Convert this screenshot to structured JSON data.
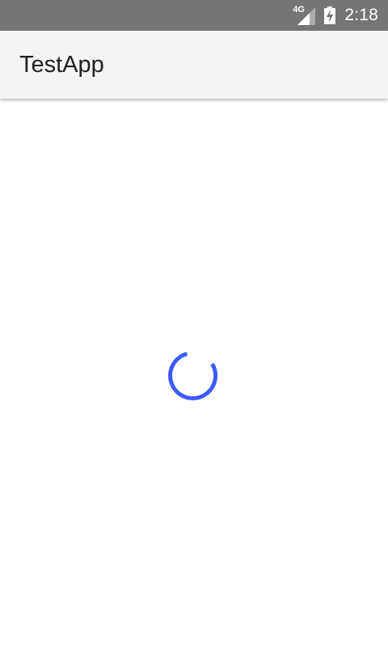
{
  "status_bar": {
    "network_type": "4G",
    "time": "2:18",
    "icons": [
      "signal-icon",
      "battery-charging-icon"
    ]
  },
  "app_bar": {
    "title": "TestApp"
  },
  "content": {
    "loading_indicator": "spinner-icon"
  },
  "colors": {
    "status_bar_bg": "#757575",
    "app_bar_bg": "#f4f4f4",
    "title_text": "#212121",
    "spinner_accent": "#3d5afe",
    "background": "#ffffff"
  }
}
